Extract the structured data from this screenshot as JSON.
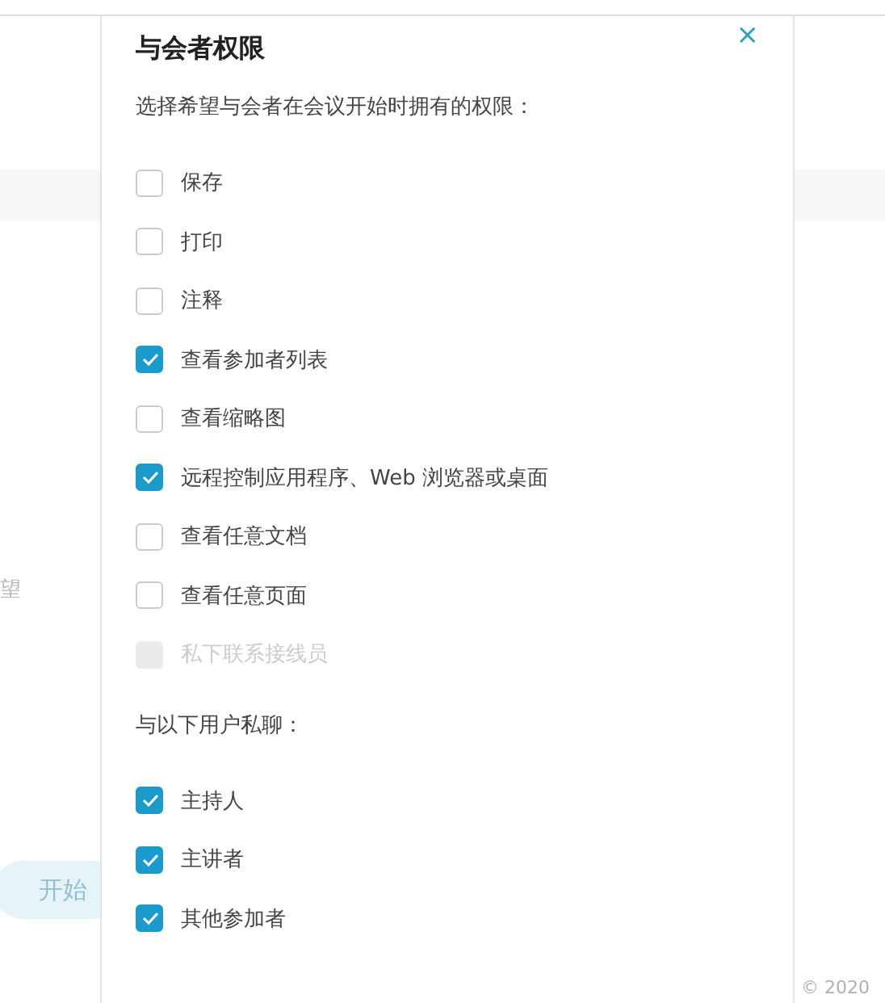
{
  "background": {
    "side_text": "望",
    "start_button": "开始",
    "footer": "© 2020"
  },
  "dialog": {
    "title": "与会者权限",
    "close": "×",
    "intro": "选择希望与会者在会议开始时拥有的权限：",
    "permissions": [
      {
        "label": "保存",
        "checked": false,
        "disabled": false
      },
      {
        "label": "打印",
        "checked": false,
        "disabled": false
      },
      {
        "label": "注释",
        "checked": false,
        "disabled": false
      },
      {
        "label": "查看参加者列表",
        "checked": true,
        "disabled": false
      },
      {
        "label": "查看缩略图",
        "checked": false,
        "disabled": false
      },
      {
        "label": "远程控制应用程序、Web 浏览器或桌面",
        "checked": true,
        "disabled": false
      },
      {
        "label": "查看任意文档",
        "checked": false,
        "disabled": false
      },
      {
        "label": "查看任意页面",
        "checked": false,
        "disabled": false
      },
      {
        "label": "私下联系接线员",
        "checked": false,
        "disabled": true
      }
    ],
    "chat_heading": "与以下用户私聊：",
    "chat": [
      {
        "label": "主持人",
        "checked": true,
        "disabled": false
      },
      {
        "label": "主讲者",
        "checked": true,
        "disabled": false
      },
      {
        "label": "其他参加者",
        "checked": true,
        "disabled": false
      }
    ]
  }
}
